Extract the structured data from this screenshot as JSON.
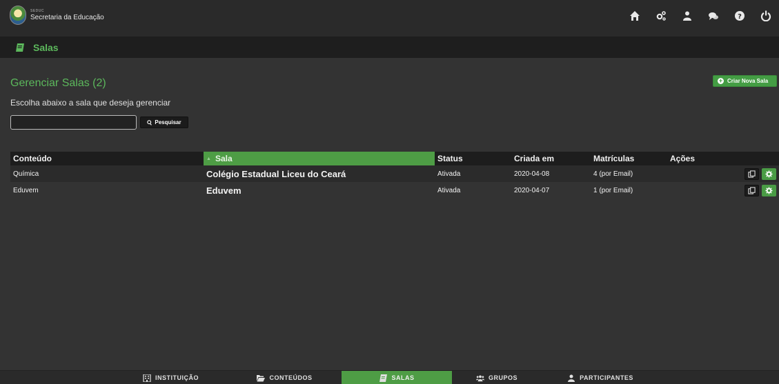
{
  "header": {
    "brand_small": "SEDUC",
    "brand_name": "Secretaria da Educação",
    "icons": [
      "home-icon",
      "cogs-icon",
      "user-icon",
      "comments-icon",
      "question-icon",
      "power-icon"
    ]
  },
  "page": {
    "title": "Salas",
    "icon": "book-icon"
  },
  "main": {
    "section_title": "Gerenciar Salas (2)",
    "instructions": "Escolha abaixo a sala que deseja gerenciar",
    "create_button": "Criar Nova Sala",
    "search": {
      "value": "",
      "button": "Pesquisar"
    }
  },
  "table": {
    "columns": [
      "Conteúdo",
      "Sala",
      "Status",
      "Criada em",
      "Matrículas",
      "Ações"
    ],
    "sorted_column": "Sala",
    "rows": [
      {
        "conteudo": "Química",
        "sala": "Colégio Estadual Liceu do Ceará",
        "status": "Ativada",
        "criada_em": "2020-04-08",
        "matriculas": "4 (por Email)"
      },
      {
        "conteudo": "Eduvem",
        "sala": "Eduvem",
        "status": "Ativada",
        "criada_em": "2020-04-07",
        "matriculas": "1 (por Email)"
      }
    ]
  },
  "bottom_nav": {
    "items": [
      {
        "label": "INSTITUIÇÃO",
        "icon": "building-icon"
      },
      {
        "label": "CONTEÚDOS",
        "icon": "folder-open-icon"
      },
      {
        "label": "SALAS",
        "icon": "book-icon"
      },
      {
        "label": "GRUPOS",
        "icon": "group-icon"
      },
      {
        "label": "PARTICIPANTES",
        "icon": "user-icon"
      }
    ],
    "active": "SALAS"
  },
  "colors": {
    "accent": "#5cb85c",
    "active_nav": "#4e9d45",
    "background": "#333333"
  }
}
